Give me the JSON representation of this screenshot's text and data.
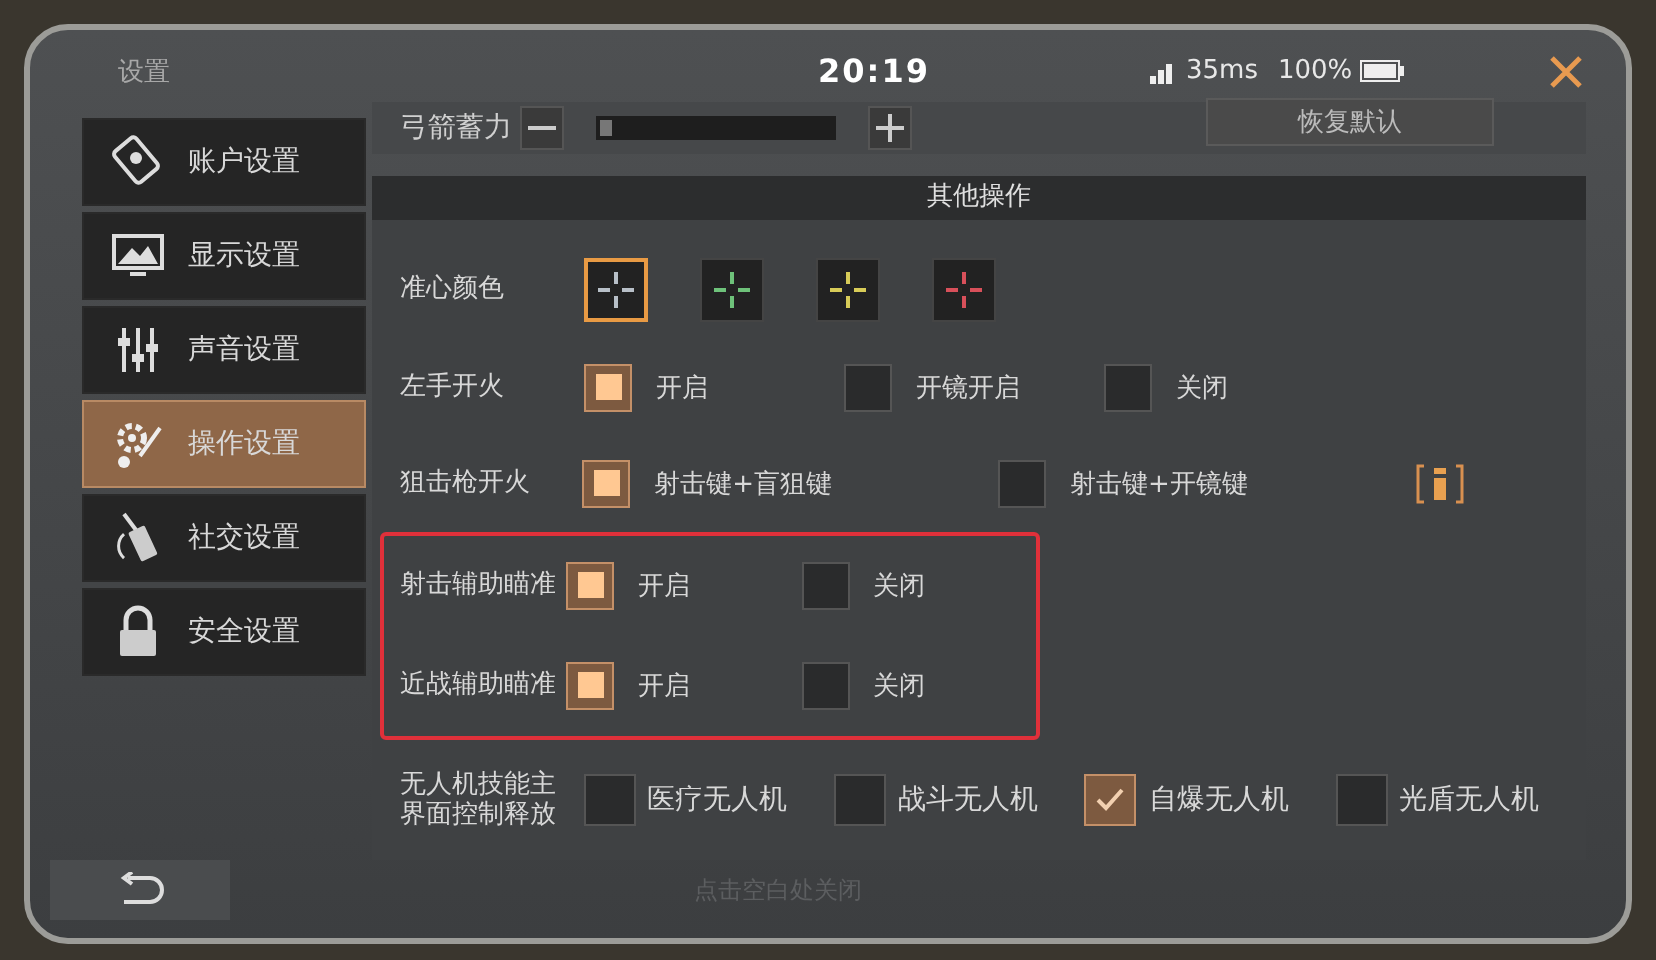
{
  "window": {
    "title": "设置",
    "time": "20:19",
    "ping": "35ms",
    "battery": "100%"
  },
  "sidebar": {
    "items": [
      {
        "label": "账户设置",
        "selected": false
      },
      {
        "label": "显示设置",
        "selected": false
      },
      {
        "label": "声音设置",
        "selected": false
      },
      {
        "label": "操作设置",
        "selected": true
      },
      {
        "label": "社交设置",
        "selected": false
      },
      {
        "label": "安全设置",
        "selected": false
      }
    ]
  },
  "bow_charge": {
    "label": "弓箭蓄力",
    "level": 0.04
  },
  "reset_button": "恢复默认",
  "section_title": "其他操作",
  "rows": [
    {
      "kind": "color",
      "label": "准心颜色",
      "highlighted": false,
      "options": [
        {
          "color": "#b8c0c8",
          "selected": true
        },
        {
          "color": "#6ec27a",
          "selected": false
        },
        {
          "color": "#d8cc58",
          "selected": false
        },
        {
          "color": "#d8505a",
          "selected": false
        }
      ]
    },
    {
      "kind": "choice",
      "label": "左手开火",
      "highlighted": false,
      "options": [
        {
          "label": "开启",
          "selected": true
        },
        {
          "label": "开镜开启",
          "selected": false
        },
        {
          "label": "关闭",
          "selected": false
        }
      ]
    },
    {
      "kind": "choice_wide",
      "label": "狙击枪开火",
      "highlighted": false,
      "info": true,
      "options": [
        {
          "label": "射击键+盲狙键",
          "selected": true
        },
        {
          "label": "射击键+开镜键",
          "selected": false
        }
      ]
    },
    {
      "kind": "choice",
      "label": "射击辅助瞄准",
      "highlighted": true,
      "options": [
        {
          "label": "开启",
          "selected": true
        },
        {
          "label": "关闭",
          "selected": false
        }
      ]
    },
    {
      "kind": "choice",
      "label": "近战辅助瞄准",
      "highlighted": true,
      "options": [
        {
          "label": "开启",
          "selected": true
        },
        {
          "label": "关闭",
          "selected": false
        }
      ]
    },
    {
      "kind": "multi",
      "label": "无人机技能主界面控制释放",
      "highlighted": false,
      "options": [
        {
          "label": "医疗无人机",
          "selected": false
        },
        {
          "label": "战斗无人机",
          "selected": false
        },
        {
          "label": "自爆无人机",
          "selected": true
        },
        {
          "label": "光盾无人机",
          "selected": false
        }
      ]
    }
  ],
  "footer_hint": "点击空白处关闭"
}
